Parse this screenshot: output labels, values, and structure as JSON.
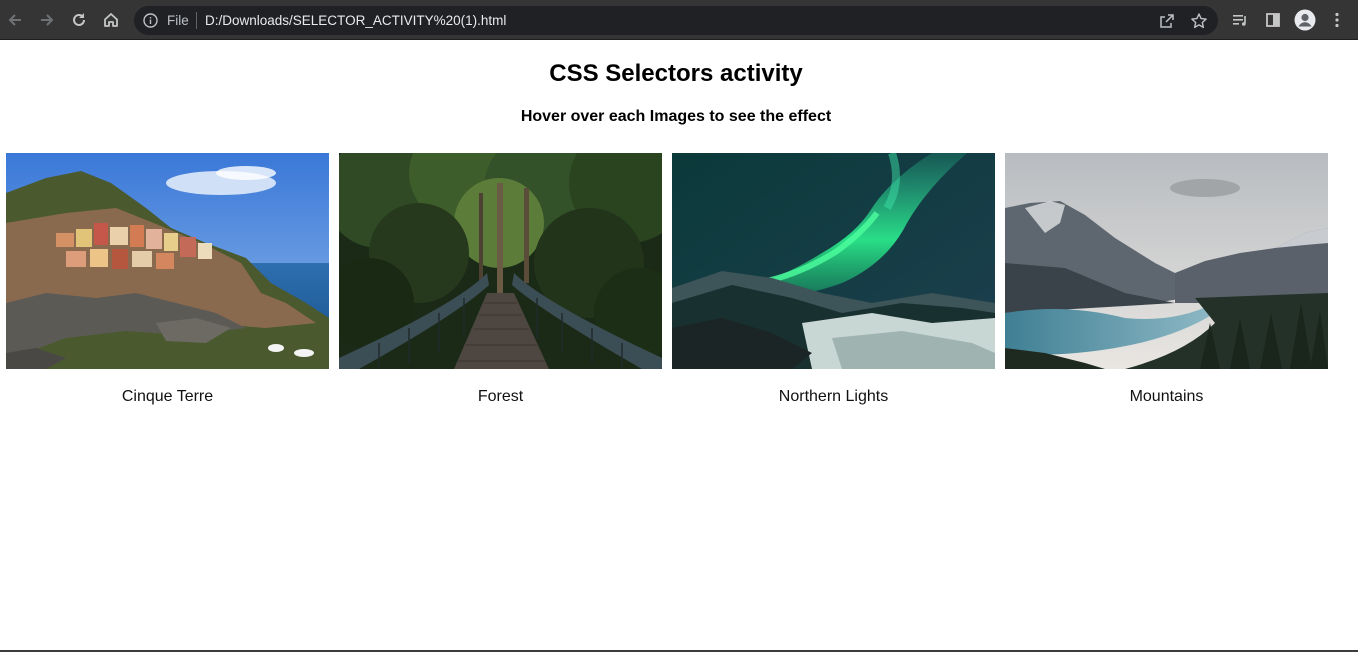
{
  "browser": {
    "address_bar": {
      "scheme_label": "File",
      "url": "D:/Downloads/SELECTOR_ACTIVITY%20(1).html"
    },
    "icons": [
      "back-icon",
      "forward-icon",
      "reload-icon",
      "home-icon",
      "site-info-icon",
      "share-icon",
      "star-icon",
      "media-queue-icon",
      "side-panel-icon",
      "profile-icon",
      "menu-icon"
    ],
    "colors": {
      "toolbar": "#353535",
      "omnibox": "#202124",
      "icon": "#c4c7c5"
    }
  },
  "page": {
    "title": "CSS Selectors activity",
    "subtitle": "Hover over each Images to see the effect",
    "gallery": [
      {
        "caption": "Cinque Terre",
        "image": "coastal-cliff-village"
      },
      {
        "caption": "Forest",
        "image": "forest-bridge"
      },
      {
        "caption": "Northern Lights",
        "image": "aurora-over-snowy-mountains"
      },
      {
        "caption": "Mountains",
        "image": "mountain-lake-valley"
      }
    ]
  }
}
